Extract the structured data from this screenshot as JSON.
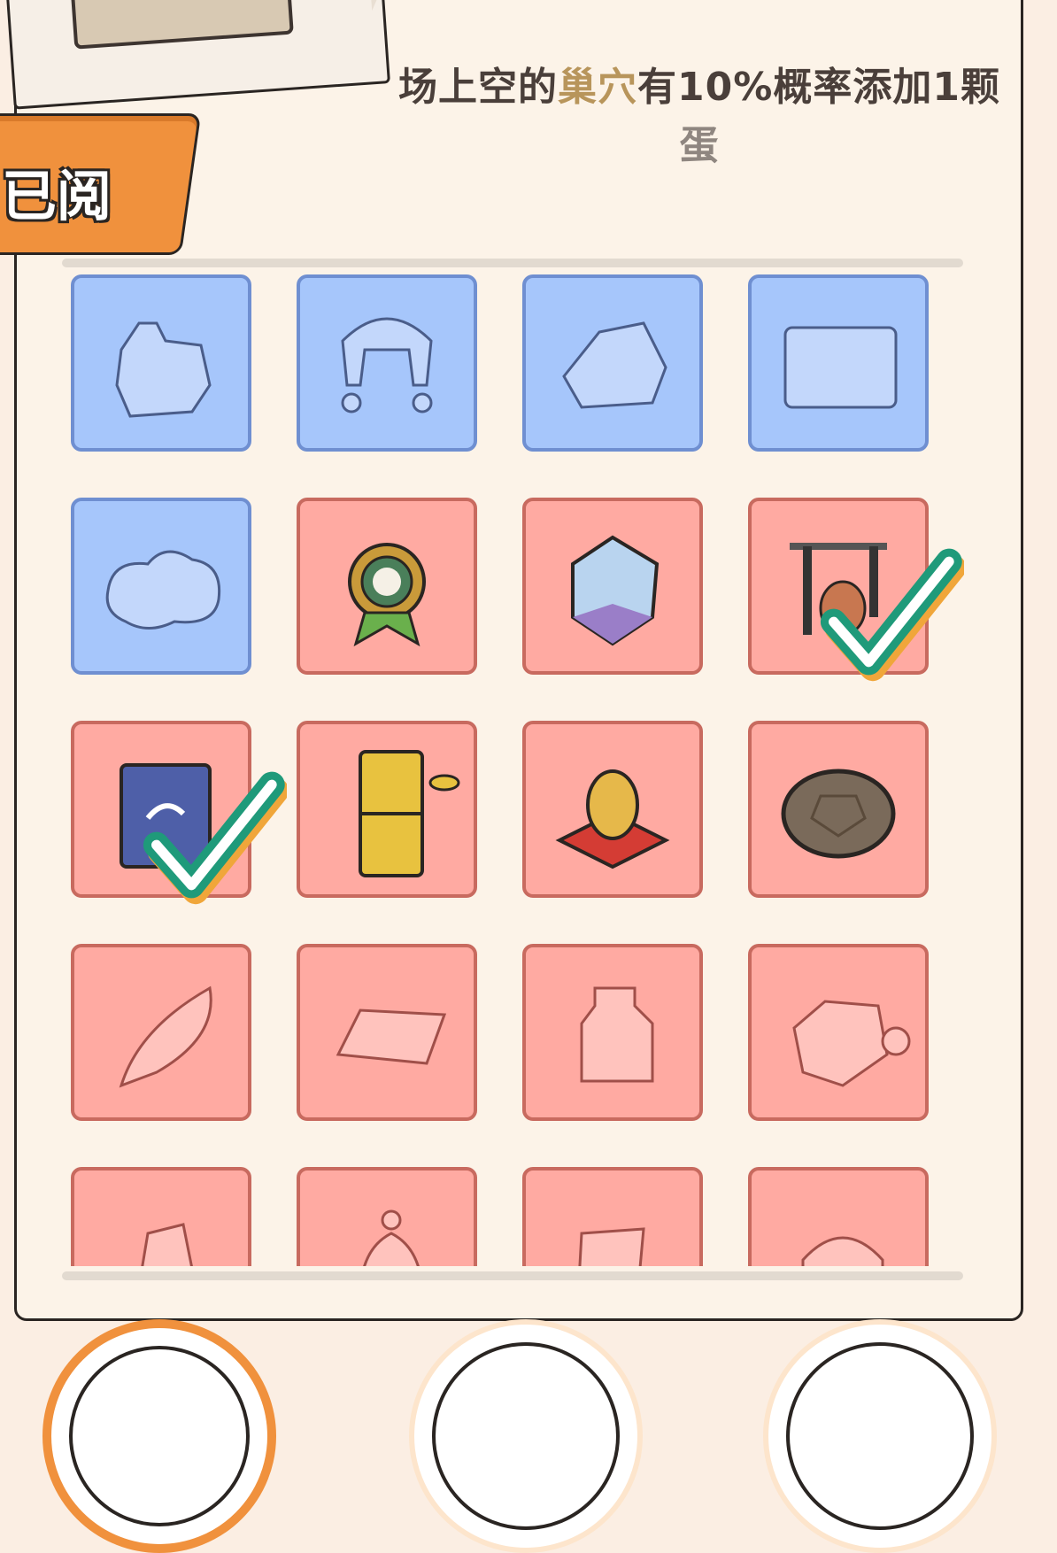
{
  "description": {
    "part1": "场上空的",
    "highlight": "巢穴",
    "part2": "有10%概率添加1颗",
    "dim": "蛋"
  },
  "read_tab": {
    "label": "已阅"
  },
  "colors": {
    "unlocked_cell": "#ffaaa2",
    "locked_cell": "#a6c6fb",
    "accent": "#f0913d",
    "check": "#1f9a7a"
  },
  "items": [
    {
      "name": "item-1",
      "tier": "blue",
      "state": "locked",
      "icon": "silhouette-glove-icon"
    },
    {
      "name": "item-2",
      "tier": "blue",
      "state": "locked",
      "icon": "silhouette-hat-icon"
    },
    {
      "name": "item-3",
      "tier": "blue",
      "state": "locked",
      "icon": "silhouette-rock-icon"
    },
    {
      "name": "item-4",
      "tier": "blue",
      "state": "locked",
      "icon": "silhouette-frame-icon"
    },
    {
      "name": "item-5",
      "tier": "blue",
      "state": "locked",
      "icon": "silhouette-cloud-icon"
    },
    {
      "name": "item-6",
      "tier": "pink",
      "state": "unlocked",
      "icon": "medal-icon"
    },
    {
      "name": "item-7",
      "tier": "pink",
      "state": "unlocked",
      "icon": "crystal-icon"
    },
    {
      "name": "item-8",
      "tier": "pink",
      "state": "unlocked",
      "icon": "tool-rack-icon",
      "checked": true
    },
    {
      "name": "item-9",
      "tier": "pink",
      "state": "unlocked",
      "icon": "book-icon",
      "checked": true
    },
    {
      "name": "item-10",
      "tier": "pink",
      "state": "unlocked",
      "icon": "bamboo-icon"
    },
    {
      "name": "item-11",
      "tier": "pink",
      "state": "unlocked",
      "icon": "golden-egg-icon"
    },
    {
      "name": "item-12",
      "tier": "pink",
      "state": "unlocked",
      "icon": "turtle-shell-icon"
    },
    {
      "name": "item-13",
      "tier": "pink",
      "state": "locked",
      "icon": "silhouette-feather-icon"
    },
    {
      "name": "item-14",
      "tier": "pink",
      "state": "locked",
      "icon": "silhouette-cloth-icon"
    },
    {
      "name": "item-15",
      "tier": "pink",
      "state": "locked",
      "icon": "silhouette-jar-icon"
    },
    {
      "name": "item-16",
      "tier": "pink",
      "state": "locked",
      "icon": "silhouette-mug-icon"
    },
    {
      "name": "item-17",
      "tier": "pink",
      "state": "locked",
      "icon": "silhouette-stone-icon"
    },
    {
      "name": "item-18",
      "tier": "pink",
      "state": "locked",
      "icon": "silhouette-bag-icon"
    },
    {
      "name": "item-19",
      "tier": "pink",
      "state": "locked",
      "icon": "silhouette-map-icon"
    },
    {
      "name": "item-20",
      "tier": "pink",
      "state": "locked",
      "icon": "silhouette-cage-icon"
    }
  ],
  "bottom_nav": [
    {
      "name": "nav-button-1",
      "active": true
    },
    {
      "name": "nav-button-2",
      "active": false
    },
    {
      "name": "nav-button-3",
      "active": false
    }
  ]
}
